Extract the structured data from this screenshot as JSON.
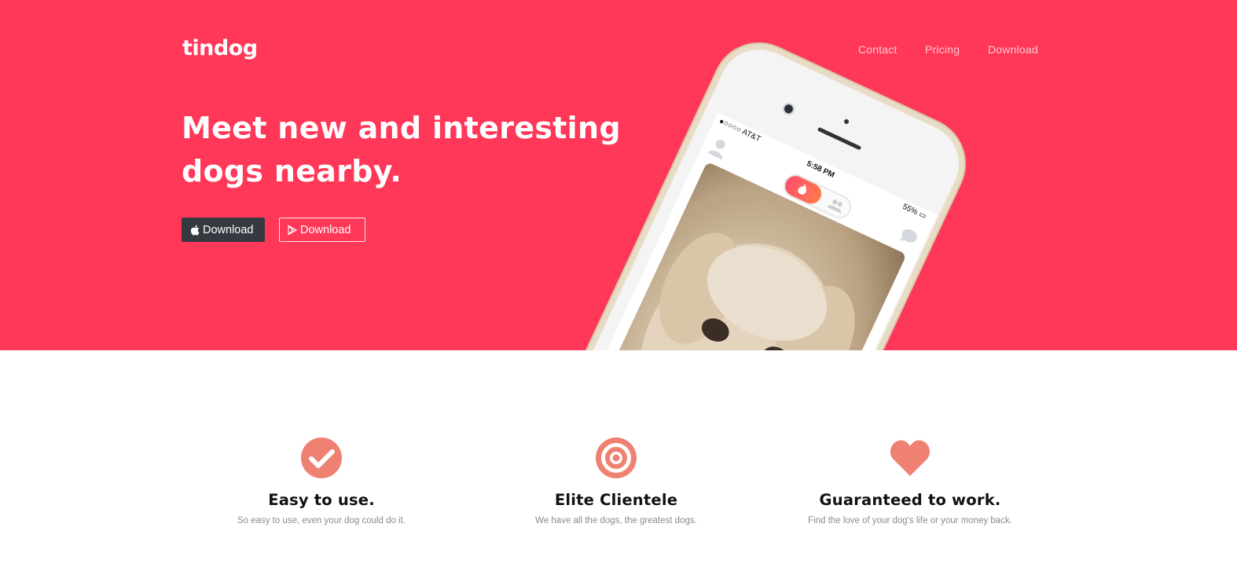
{
  "brand": {
    "name": "tindog"
  },
  "nav": {
    "items": [
      "Contact",
      "Pricing",
      "Download"
    ]
  },
  "hero": {
    "title_line1": "Meet new and interesting",
    "title_line2": "dogs nearby.",
    "buttons": [
      {
        "label": "Download",
        "icon": "apple-icon",
        "style": "dark"
      },
      {
        "label": "Download",
        "icon": "google-play-icon",
        "style": "outline"
      }
    ]
  },
  "phone": {
    "carrier": "AT&T",
    "time": "5:58 PM",
    "battery": "55%"
  },
  "features": [
    {
      "icon": "check-circle-icon",
      "title": "Easy to use.",
      "text": "So easy to use, even your dog could do it."
    },
    {
      "icon": "bullseye-icon",
      "title": "Elite Clientele",
      "text": "We have all the dogs, the greatest dogs."
    },
    {
      "icon": "heart-icon",
      "title": "Guaranteed to work.",
      "text": "Find the love of your dog's life or your money back."
    }
  ],
  "colors": {
    "hero_bg": "#ff3758",
    "accent": "#ef8172",
    "dark_button": "#343a40"
  }
}
